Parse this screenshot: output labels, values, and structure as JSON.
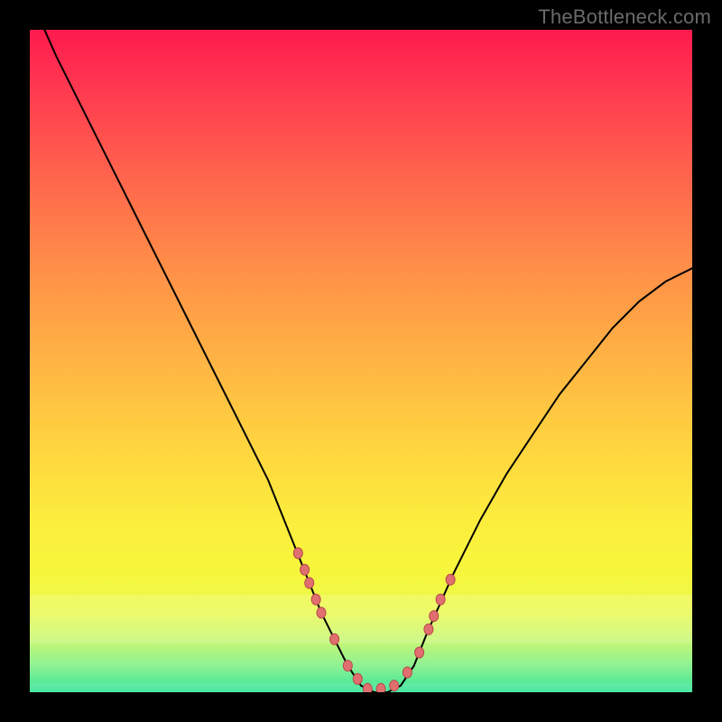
{
  "watermark": "TheBottleneck.com",
  "colors": {
    "marker_fill": "#e06f6f",
    "marker_stroke": "#b94a4a",
    "curve": "#000000"
  },
  "chart_data": {
    "type": "line",
    "title": "",
    "xlabel": "",
    "ylabel": "",
    "xlim": [
      0,
      100
    ],
    "ylim": [
      0,
      100
    ],
    "series": [
      {
        "name": "bottleneck-curve",
        "x": [
          0,
          4,
          8,
          12,
          16,
          20,
          24,
          28,
          32,
          36,
          40,
          42,
          44,
          46,
          48,
          50,
          52,
          54,
          56,
          58,
          60,
          64,
          68,
          72,
          76,
          80,
          84,
          88,
          92,
          96,
          100
        ],
        "y": [
          105,
          96,
          88,
          80,
          72,
          64,
          56,
          48,
          40,
          32,
          22,
          17,
          12,
          8,
          4,
          1,
          0,
          0,
          1,
          4,
          9,
          18,
          26,
          33,
          39,
          45,
          50,
          55,
          59,
          62,
          64
        ]
      }
    ],
    "markers": {
      "name": "highlight-dots",
      "x": [
        40.5,
        41.5,
        42.2,
        43.2,
        44.0,
        46.0,
        48.0,
        49.5,
        51.0,
        53.0,
        55.0,
        57.0,
        58.8,
        60.2,
        61.0,
        62.0,
        63.5
      ],
      "y": [
        21,
        18.5,
        16.5,
        14,
        12,
        8,
        4,
        2,
        0.5,
        0.5,
        1,
        3,
        6,
        9.5,
        11.5,
        14,
        17
      ],
      "rx": 5,
      "ry": 6
    }
  }
}
